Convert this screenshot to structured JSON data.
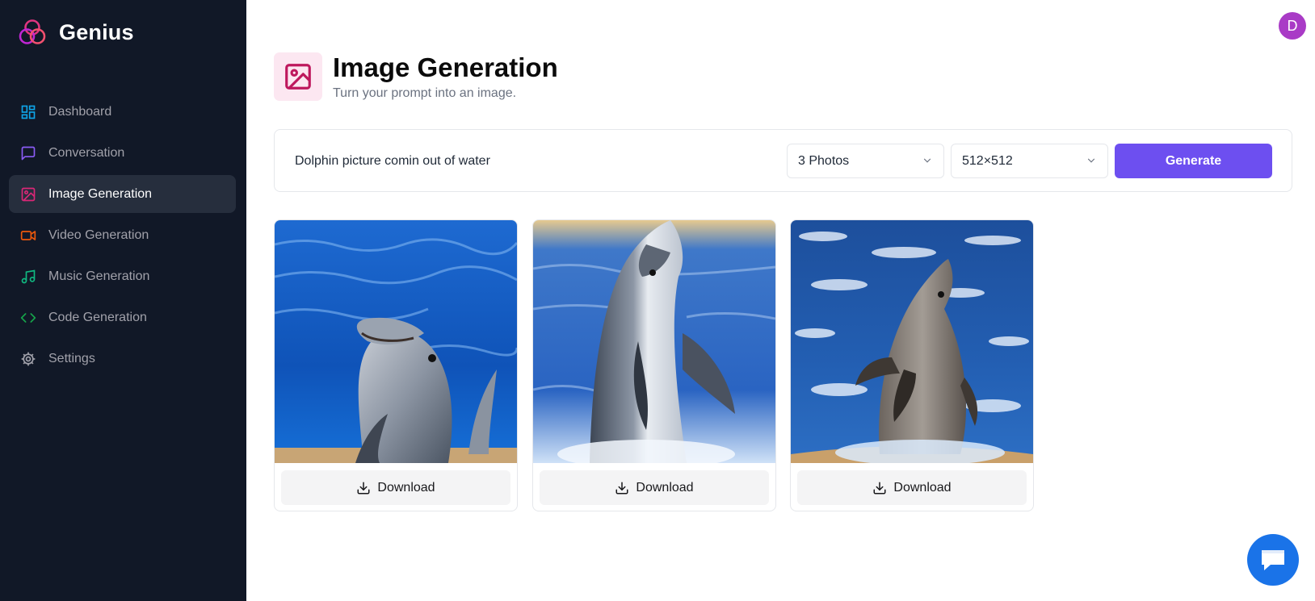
{
  "app": {
    "name": "Genius"
  },
  "sidebar": {
    "items": [
      {
        "label": "Dashboard",
        "icon": "dashboard-icon",
        "color": "#0ea5e9",
        "active": false
      },
      {
        "label": "Conversation",
        "icon": "message-square-icon",
        "color": "#8b5cf6",
        "active": false
      },
      {
        "label": "Image Generation",
        "icon": "image-icon",
        "color": "#db2777",
        "active": true
      },
      {
        "label": "Video Generation",
        "icon": "video-icon",
        "color": "#ea580c",
        "active": false
      },
      {
        "label": "Music Generation",
        "icon": "music-icon",
        "color": "#10b981",
        "active": false
      },
      {
        "label": "Code Generation",
        "icon": "code-icon",
        "color": "#16a34a",
        "active": false
      },
      {
        "label": "Settings",
        "icon": "gear-icon",
        "color": "#a1a1aa",
        "active": false
      }
    ]
  },
  "user": {
    "avatar_letter": "D",
    "avatar_color": "#a93bc6"
  },
  "page": {
    "title": "Image Generation",
    "subtitle": "Turn your prompt into an image.",
    "icon": "image-icon",
    "icon_color": "#be185d"
  },
  "form": {
    "prompt": "Dolphin picture comin out of water",
    "amount": "3 Photos",
    "resolution": "512×512",
    "generate_label": "Generate",
    "accent": "#6d4ff0"
  },
  "results": [
    {
      "alt": "dolphin photo 1",
      "download_label": "Download"
    },
    {
      "alt": "dolphin photo 2",
      "download_label": "Download"
    },
    {
      "alt": "dolphin photo 3",
      "download_label": "Download"
    }
  ],
  "support_chat": {
    "icon": "chat-bubble-icon",
    "color": "#1a73e8"
  }
}
